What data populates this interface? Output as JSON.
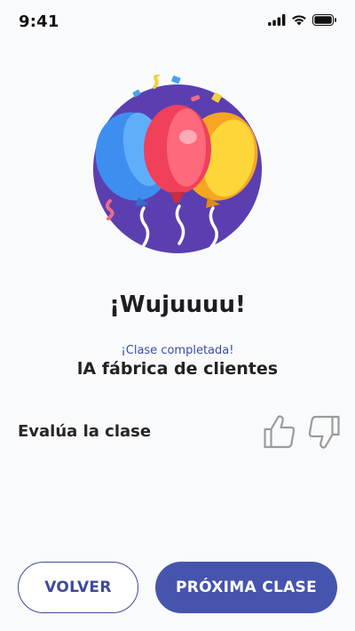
{
  "status_bar": {
    "time": "9:41"
  },
  "celebration": {
    "title": "¡Wujuuuu!",
    "subtitle": "¡Clase completada!",
    "class_name": "lA fábrica de clientes"
  },
  "rating": {
    "label": "Evalúa la clase",
    "up_icon": "thumbs-up-icon",
    "down_icon": "thumbs-down-icon"
  },
  "actions": {
    "back_label": "VOLVER",
    "next_label": "PRÓXIMA CLASE"
  },
  "colors": {
    "primary": "#4654ae",
    "subtitle": "#3b4d9f",
    "circle": "#5b3fb0"
  }
}
